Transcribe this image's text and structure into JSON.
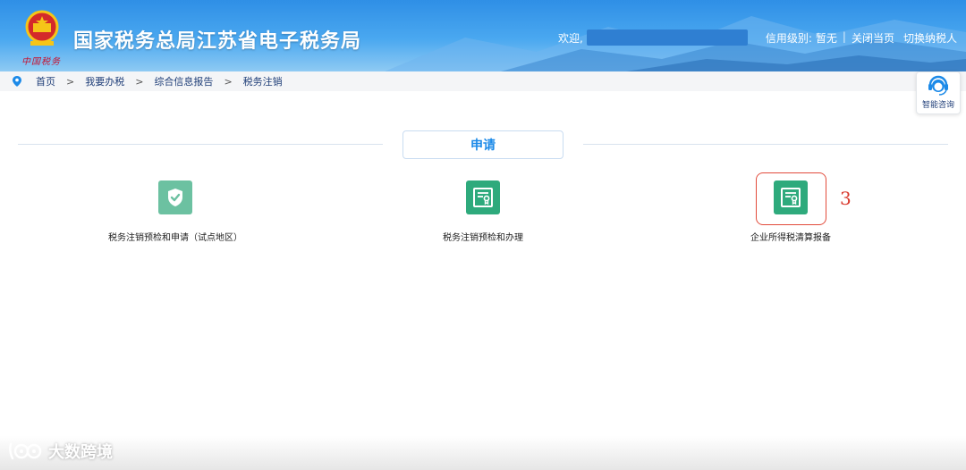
{
  "header": {
    "site_title": "国家税务总局江苏省电子税务局",
    "welcome": "欢迎,",
    "credit_label": "信用级别:",
    "credit_value": "暂无",
    "close_page": "关闭当页",
    "switch_taxpayer": "切换纳税人",
    "emblem_sign": "中国税务"
  },
  "breadcrumb": {
    "items": [
      "首页",
      "我要办税",
      "综合信息报告",
      "税务注销"
    ],
    "separator": ">"
  },
  "assistant": {
    "label": "智能咨询"
  },
  "section": {
    "tab_label": "申请"
  },
  "services": [
    {
      "label": "税务注销预检和申请（试点地区）",
      "icon": "shield-check-icon"
    },
    {
      "label": "税务注销预检和办理",
      "icon": "certificate-icon"
    },
    {
      "label": "企业所得税清算报备",
      "icon": "certificate-icon"
    }
  ],
  "annotation": {
    "step": "3"
  },
  "watermark": {
    "text": "大数跨境"
  },
  "colors": {
    "header_blue": "#2f8fe6",
    "accent_blue": "#1c8ae8",
    "tile_green": "#2eaa7c",
    "tile_green_light": "#6cc1a1",
    "highlight_red": "#e24b3b"
  }
}
